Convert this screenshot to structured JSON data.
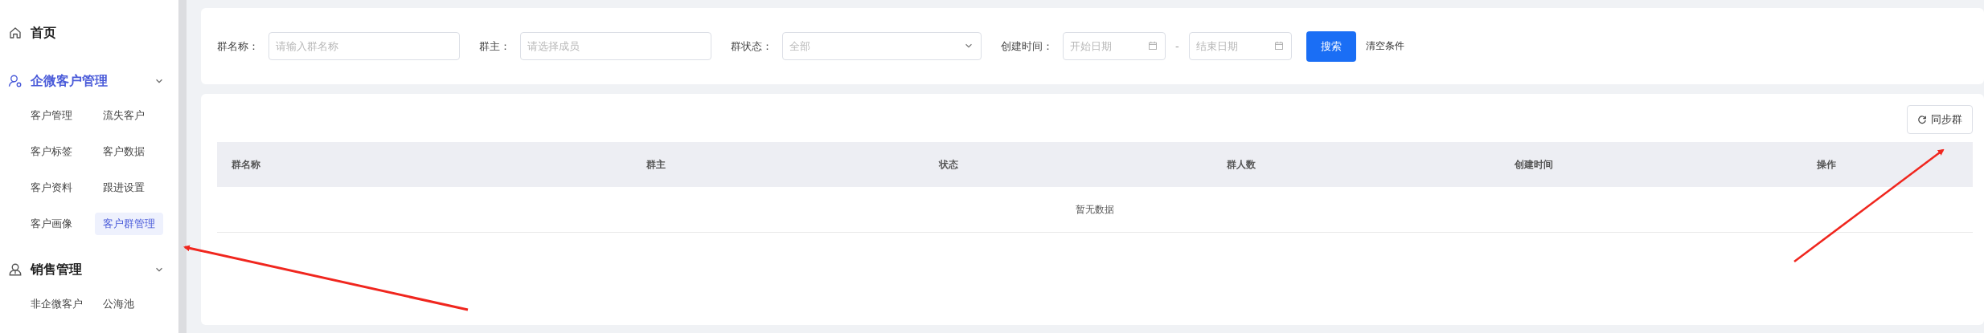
{
  "sidebar": {
    "items": [
      {
        "label": "首页",
        "active": false
      },
      {
        "label": "企微客户管理",
        "active": true,
        "expanded": true,
        "children": [
          {
            "label": "客户管理",
            "selected": false
          },
          {
            "label": "流失客户",
            "selected": false
          },
          {
            "label": "客户标签",
            "selected": false
          },
          {
            "label": "客户数据",
            "selected": false
          },
          {
            "label": "客户资料",
            "selected": false
          },
          {
            "label": "跟进设置",
            "selected": false
          },
          {
            "label": "客户画像",
            "selected": false
          },
          {
            "label": "客户群管理",
            "selected": true
          }
        ]
      },
      {
        "label": "销售管理",
        "active": false,
        "expanded": true,
        "children": [
          {
            "label": "非企微客户",
            "selected": false
          },
          {
            "label": "公海池",
            "selected": false
          }
        ]
      }
    ]
  },
  "filters": {
    "fields": [
      {
        "kind": "input",
        "label": "群名称：",
        "placeholder": "请输入群名称"
      },
      {
        "kind": "input",
        "label": "群主：",
        "placeholder": "请选择成员"
      },
      {
        "kind": "select",
        "label": "群状态：",
        "placeholder": "全部"
      },
      {
        "kind": "daterange",
        "label": "创建时间：",
        "start_placeholder": "开始日期",
        "separator": "-",
        "end_placeholder": "结束日期"
      }
    ],
    "search_button": "搜索",
    "clear_link": "清空条件"
  },
  "toolbar": {
    "sync_button": "同步群"
  },
  "table": {
    "columns": [
      "群名称",
      "群主",
      "状态",
      "群人数",
      "创建时间",
      "操作"
    ],
    "empty_text": "暂无数据"
  }
}
